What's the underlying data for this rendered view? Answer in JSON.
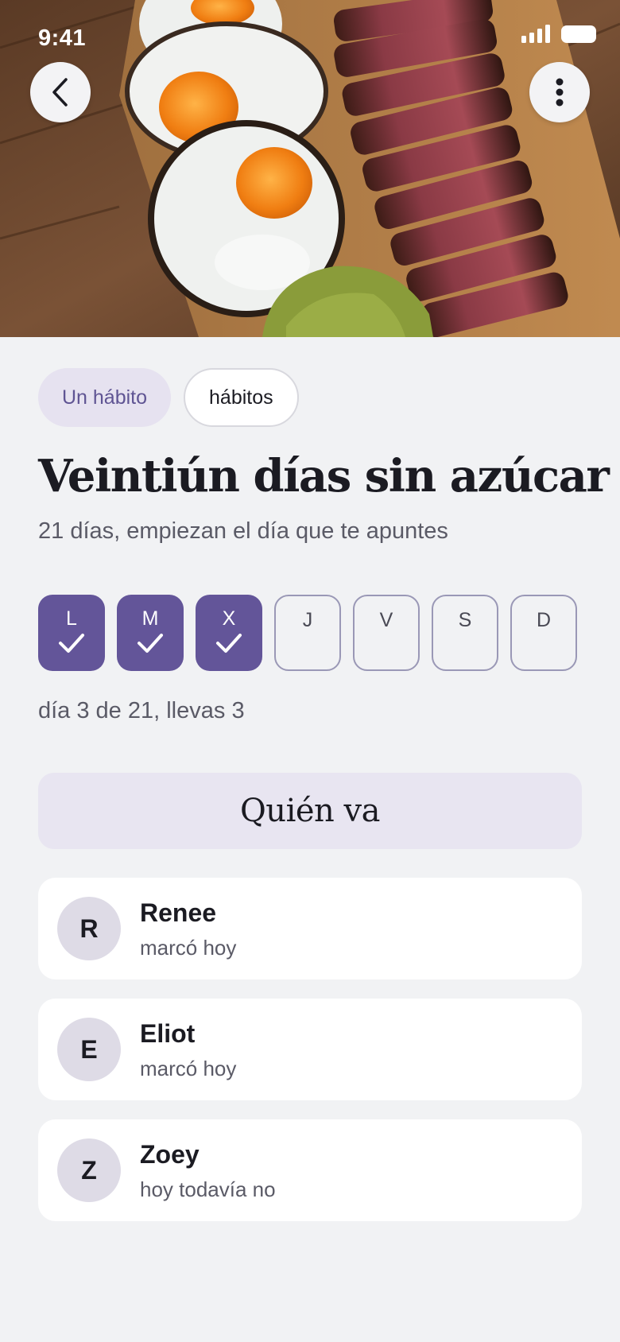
{
  "status_bar": {
    "time": "9:41"
  },
  "header": {
    "back_icon": "chevron-left-icon",
    "more_icon": "vertical-ellipsis-icon",
    "hero_image": "food-photo-steak-eggs-guacamole"
  },
  "chips": [
    {
      "label": "Un hábito",
      "selected": true
    },
    {
      "label": "hábitos",
      "selected": false
    }
  ],
  "habit": {
    "title": "Veintiún días sin azúcar",
    "subtitle": "21 días, empiezan el día que te apuntes"
  },
  "week": [
    {
      "letter": "L",
      "done": true
    },
    {
      "letter": "M",
      "done": true
    },
    {
      "letter": "X",
      "done": true
    },
    {
      "letter": "J",
      "done": false
    },
    {
      "letter": "V",
      "done": false
    },
    {
      "letter": "S",
      "done": false
    },
    {
      "letter": "D",
      "done": false
    }
  ],
  "progress": {
    "text": "día 3 de 21, llevas 3",
    "current_day": 3,
    "total_days": 21
  },
  "section": {
    "title": "Quién va"
  },
  "members": [
    {
      "initial": "R",
      "name": "Renee",
      "status": "marcó hoy"
    },
    {
      "initial": "E",
      "name": "Eliot",
      "status": "marcó hoy"
    },
    {
      "initial": "Z",
      "name": "Zoey",
      "status": "hoy todavía no"
    }
  ],
  "colors": {
    "accent": "#635599",
    "chip_bg": "#e6e2f0",
    "section_bg": "#e8e5f1",
    "page_bg": "#f1f2f4"
  }
}
